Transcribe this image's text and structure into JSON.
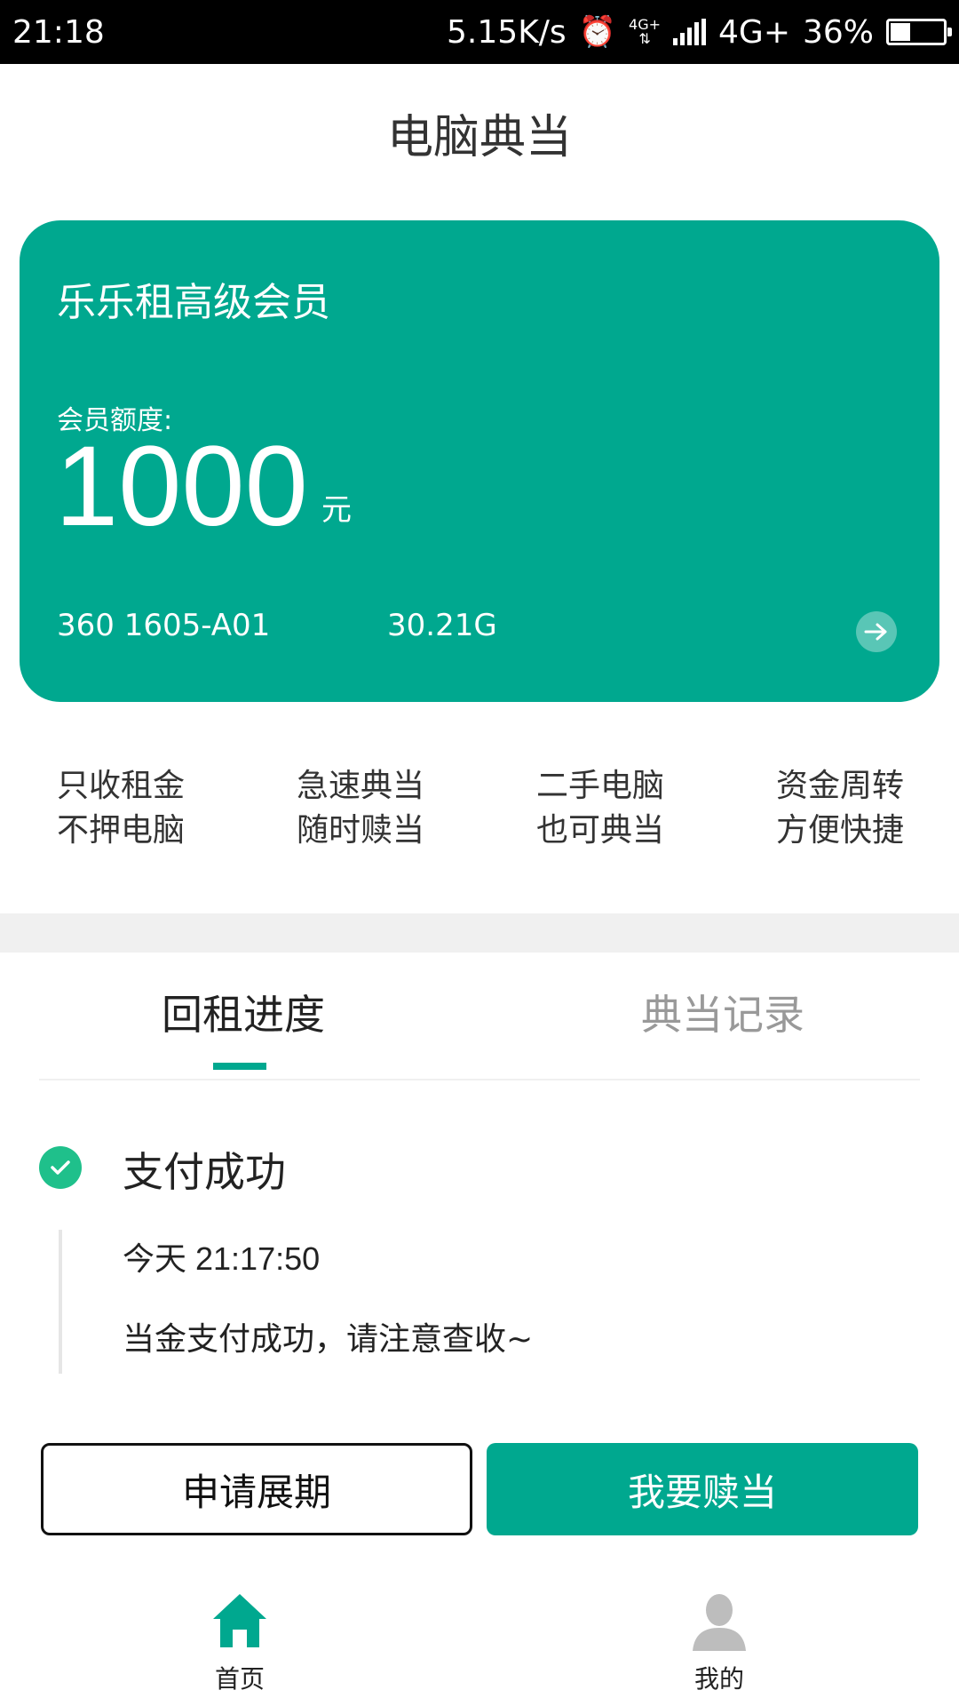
{
  "status_bar": {
    "time": "21:18",
    "speed": "5.15K/s",
    "network_small": "4G+",
    "network": "4G+",
    "battery": "36%"
  },
  "header": {
    "title": "电脑典当"
  },
  "card": {
    "title": "乐乐租高级会员",
    "quota_label": "会员额度:",
    "quota_value": "1000",
    "quota_unit": "元",
    "device_model": "360 1605-A01",
    "device_storage": "30.21G",
    "battery_level": 0.36
  },
  "features": [
    {
      "line1": "只收租金",
      "line2": "不押电脑"
    },
    {
      "line1": "急速典当",
      "line2": "随时赎当"
    },
    {
      "line1": "二手电脑",
      "line2": "也可典当"
    },
    {
      "line1": "资金周转",
      "line2": "方便快捷"
    }
  ],
  "tabs": [
    {
      "label": "回租进度",
      "active": true
    },
    {
      "label": "典当记录",
      "active": false
    }
  ],
  "progress": {
    "title": "支付成功",
    "time": "今天 21:17:50",
    "message": "当金支付成功，请注意查收~"
  },
  "buttons": {
    "extend": "申请展期",
    "redeem": "我要赎当"
  },
  "bottom_nav": [
    {
      "label": "首页",
      "icon": "home-icon"
    },
    {
      "label": "我的",
      "icon": "user-icon"
    }
  ],
  "colors": {
    "accent": "#00a88f",
    "success": "#1fc08b",
    "inactive_text": "#999999"
  }
}
